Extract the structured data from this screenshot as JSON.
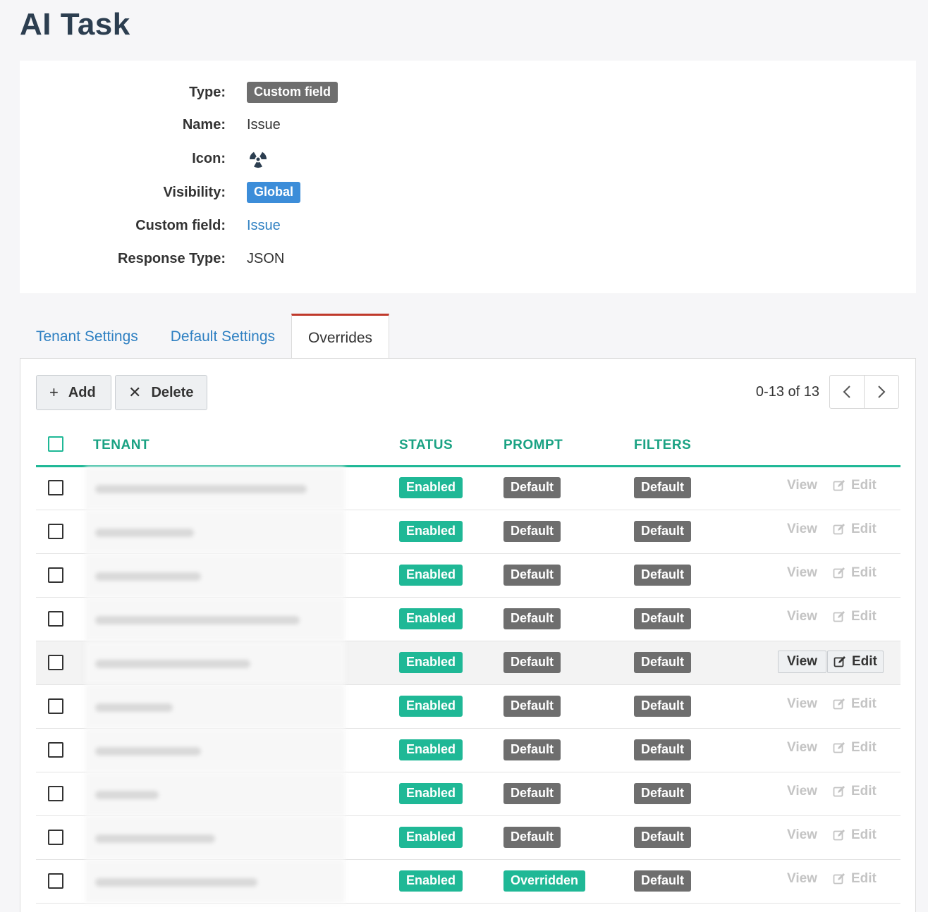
{
  "page": {
    "title": "AI Task"
  },
  "details": {
    "type_label": "Type:",
    "type_value": "Custom field",
    "name_label": "Name:",
    "name_value": "Issue",
    "icon_label": "Icon:",
    "icon_value": "radiation-icon",
    "visibility_label": "Visibility:",
    "visibility_value": "Global",
    "custom_field_label": "Custom field:",
    "custom_field_value": "Issue",
    "response_type_label": "Response Type:",
    "response_type_value": "JSON"
  },
  "tabs": [
    {
      "label": "Tenant Settings",
      "active": false
    },
    {
      "label": "Default Settings",
      "active": false
    },
    {
      "label": "Overrides",
      "active": true
    }
  ],
  "toolbar": {
    "add_label": "Add",
    "delete_label": "Delete",
    "pagination": "0-13 of 13",
    "prev_icon": "chevron-left-icon",
    "next_icon": "chevron-right-icon"
  },
  "table": {
    "headers": {
      "tenant": "TENANT",
      "status": "STATUS",
      "prompt": "PROMPT",
      "filters": "FILTERS"
    },
    "rows": [
      {
        "status": "Enabled",
        "prompt": "Default",
        "filters": "Default",
        "view": "View",
        "edit": "Edit"
      },
      {
        "status": "Enabled",
        "prompt": "Default",
        "filters": "Default",
        "view": "View",
        "edit": "Edit"
      },
      {
        "status": "Enabled",
        "prompt": "Default",
        "filters": "Default",
        "view": "View",
        "edit": "Edit"
      },
      {
        "status": "Enabled",
        "prompt": "Default",
        "filters": "Default",
        "view": "View",
        "edit": "Edit"
      },
      {
        "status": "Enabled",
        "prompt": "Default",
        "filters": "Default",
        "view": "View",
        "edit": "Edit"
      },
      {
        "status": "Enabled",
        "prompt": "Default",
        "filters": "Default",
        "view": "View",
        "edit": "Edit"
      },
      {
        "status": "Enabled",
        "prompt": "Default",
        "filters": "Default",
        "view": "View",
        "edit": "Edit"
      },
      {
        "status": "Enabled",
        "prompt": "Default",
        "filters": "Default",
        "view": "View",
        "edit": "Edit"
      },
      {
        "status": "Enabled",
        "prompt": "Default",
        "filters": "Default",
        "view": "View",
        "edit": "Edit"
      },
      {
        "status": "Enabled",
        "prompt": "Overridden",
        "filters": "Default",
        "view": "View",
        "edit": "Edit"
      }
    ]
  },
  "colors": {
    "accent": "#1fb896",
    "tab_active_border": "#c0392b",
    "link": "#2f80c2",
    "badge_gray": "#6e6e6e",
    "badge_blue": "#3c8dd9"
  }
}
